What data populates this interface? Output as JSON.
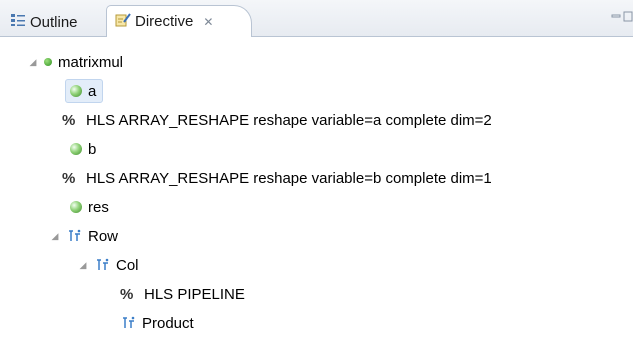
{
  "tabs": [
    {
      "label": "Outline",
      "icon": "outline-icon"
    },
    {
      "label": "Directive",
      "icon": "directive-icon",
      "close": "✕"
    }
  ],
  "tree": {
    "root": "matrixmul",
    "a": "a",
    "directive_a": "HLS ARRAY_RESHAPE reshape variable=a complete dim=2",
    "b": "b",
    "directive_b": "HLS ARRAY_RESHAPE reshape variable=b complete dim=1",
    "res": "res",
    "row": "Row",
    "col": "Col",
    "pipeline": "HLS PIPELINE",
    "product": "Product",
    "pct": "%"
  },
  "colors": {
    "accent_green": "#3d8a2a",
    "selection": "#e3edf9",
    "loop_blue": "#3b7ec8"
  }
}
